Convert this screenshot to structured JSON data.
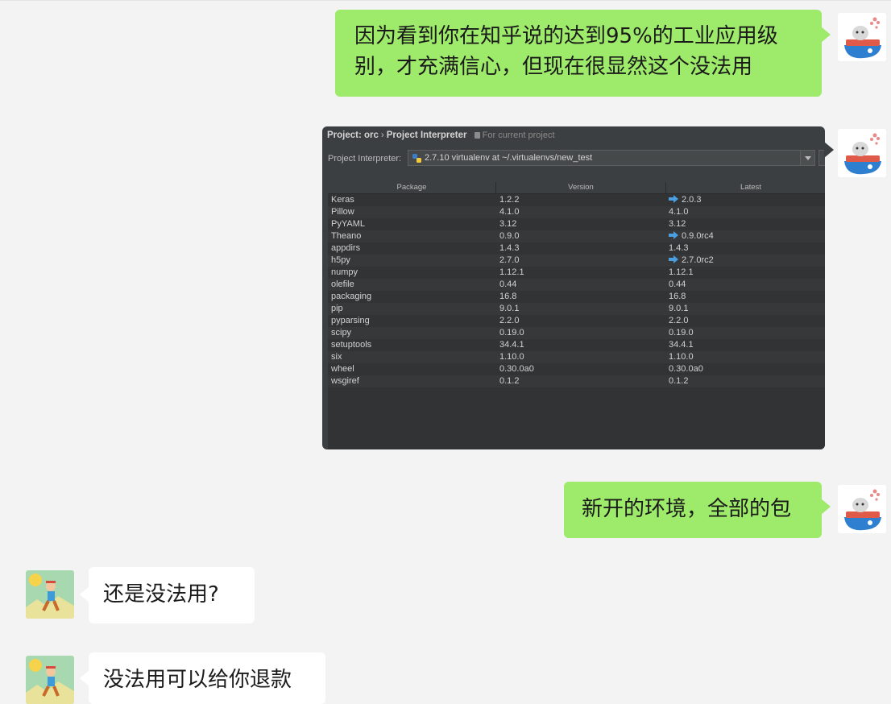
{
  "chat": {
    "messages": [
      {
        "side": "me",
        "type": "text",
        "text": "因为看到你在知乎说的达到95%的工业应用级\n别，才充满信心，但现在很显然这个没法用"
      },
      {
        "side": "me",
        "type": "image"
      },
      {
        "side": "me",
        "type": "text",
        "text": "新开的环境，全部的包"
      },
      {
        "side": "other",
        "type": "text",
        "text": "还是没法用?"
      },
      {
        "side": "other",
        "type": "text",
        "text": "没法用可以给你退款"
      }
    ]
  },
  "ide": {
    "breadcrumb": {
      "project": "Project: orc",
      "separator": "›",
      "page": "Project Interpreter",
      "note": "For current project"
    },
    "interpreter_label": "Project Interpreter:",
    "interpreter_value": "2.7.10 virtualenv at ~/.virtualenvs/new_test",
    "columns": [
      "Package",
      "Version",
      "Latest"
    ],
    "packages": [
      {
        "name": "Keras",
        "version": "1.2.2",
        "latest": "2.0.3",
        "upgrade": true
      },
      {
        "name": "Pillow",
        "version": "4.1.0",
        "latest": "4.1.0",
        "upgrade": false
      },
      {
        "name": "PyYAML",
        "version": "3.12",
        "latest": "3.12",
        "upgrade": false
      },
      {
        "name": "Theano",
        "version": "0.9.0",
        "latest": "0.9.0rc4",
        "upgrade": true
      },
      {
        "name": "appdirs",
        "version": "1.4.3",
        "latest": "1.4.3",
        "upgrade": false
      },
      {
        "name": "h5py",
        "version": "2.7.0",
        "latest": "2.7.0rc2",
        "upgrade": true
      },
      {
        "name": "numpy",
        "version": "1.12.1",
        "latest": "1.12.1",
        "upgrade": false
      },
      {
        "name": "olefile",
        "version": "0.44",
        "latest": "0.44",
        "upgrade": false
      },
      {
        "name": "packaging",
        "version": "16.8",
        "latest": "16.8",
        "upgrade": false
      },
      {
        "name": "pip",
        "version": "9.0.1",
        "latest": "9.0.1",
        "upgrade": false
      },
      {
        "name": "pyparsing",
        "version": "2.2.0",
        "latest": "2.2.0",
        "upgrade": false
      },
      {
        "name": "scipy",
        "version": "0.19.0",
        "latest": "0.19.0",
        "upgrade": false
      },
      {
        "name": "setuptools",
        "version": "34.4.1",
        "latest": "34.4.1",
        "upgrade": false
      },
      {
        "name": "six",
        "version": "1.10.0",
        "latest": "1.10.0",
        "upgrade": false
      },
      {
        "name": "wheel",
        "version": "0.30.0a0",
        "latest": "0.30.0a0",
        "upgrade": false
      },
      {
        "name": "wsgiref",
        "version": "0.1.2",
        "latest": "0.1.2",
        "upgrade": false
      }
    ]
  },
  "colors": {
    "background": "#f3f3f3",
    "my_bubble": "#9eea6a",
    "their_bubble": "#ffffff",
    "ide_bg": "#3c3f41",
    "upgrade_arrow": "#4a9fe0"
  }
}
